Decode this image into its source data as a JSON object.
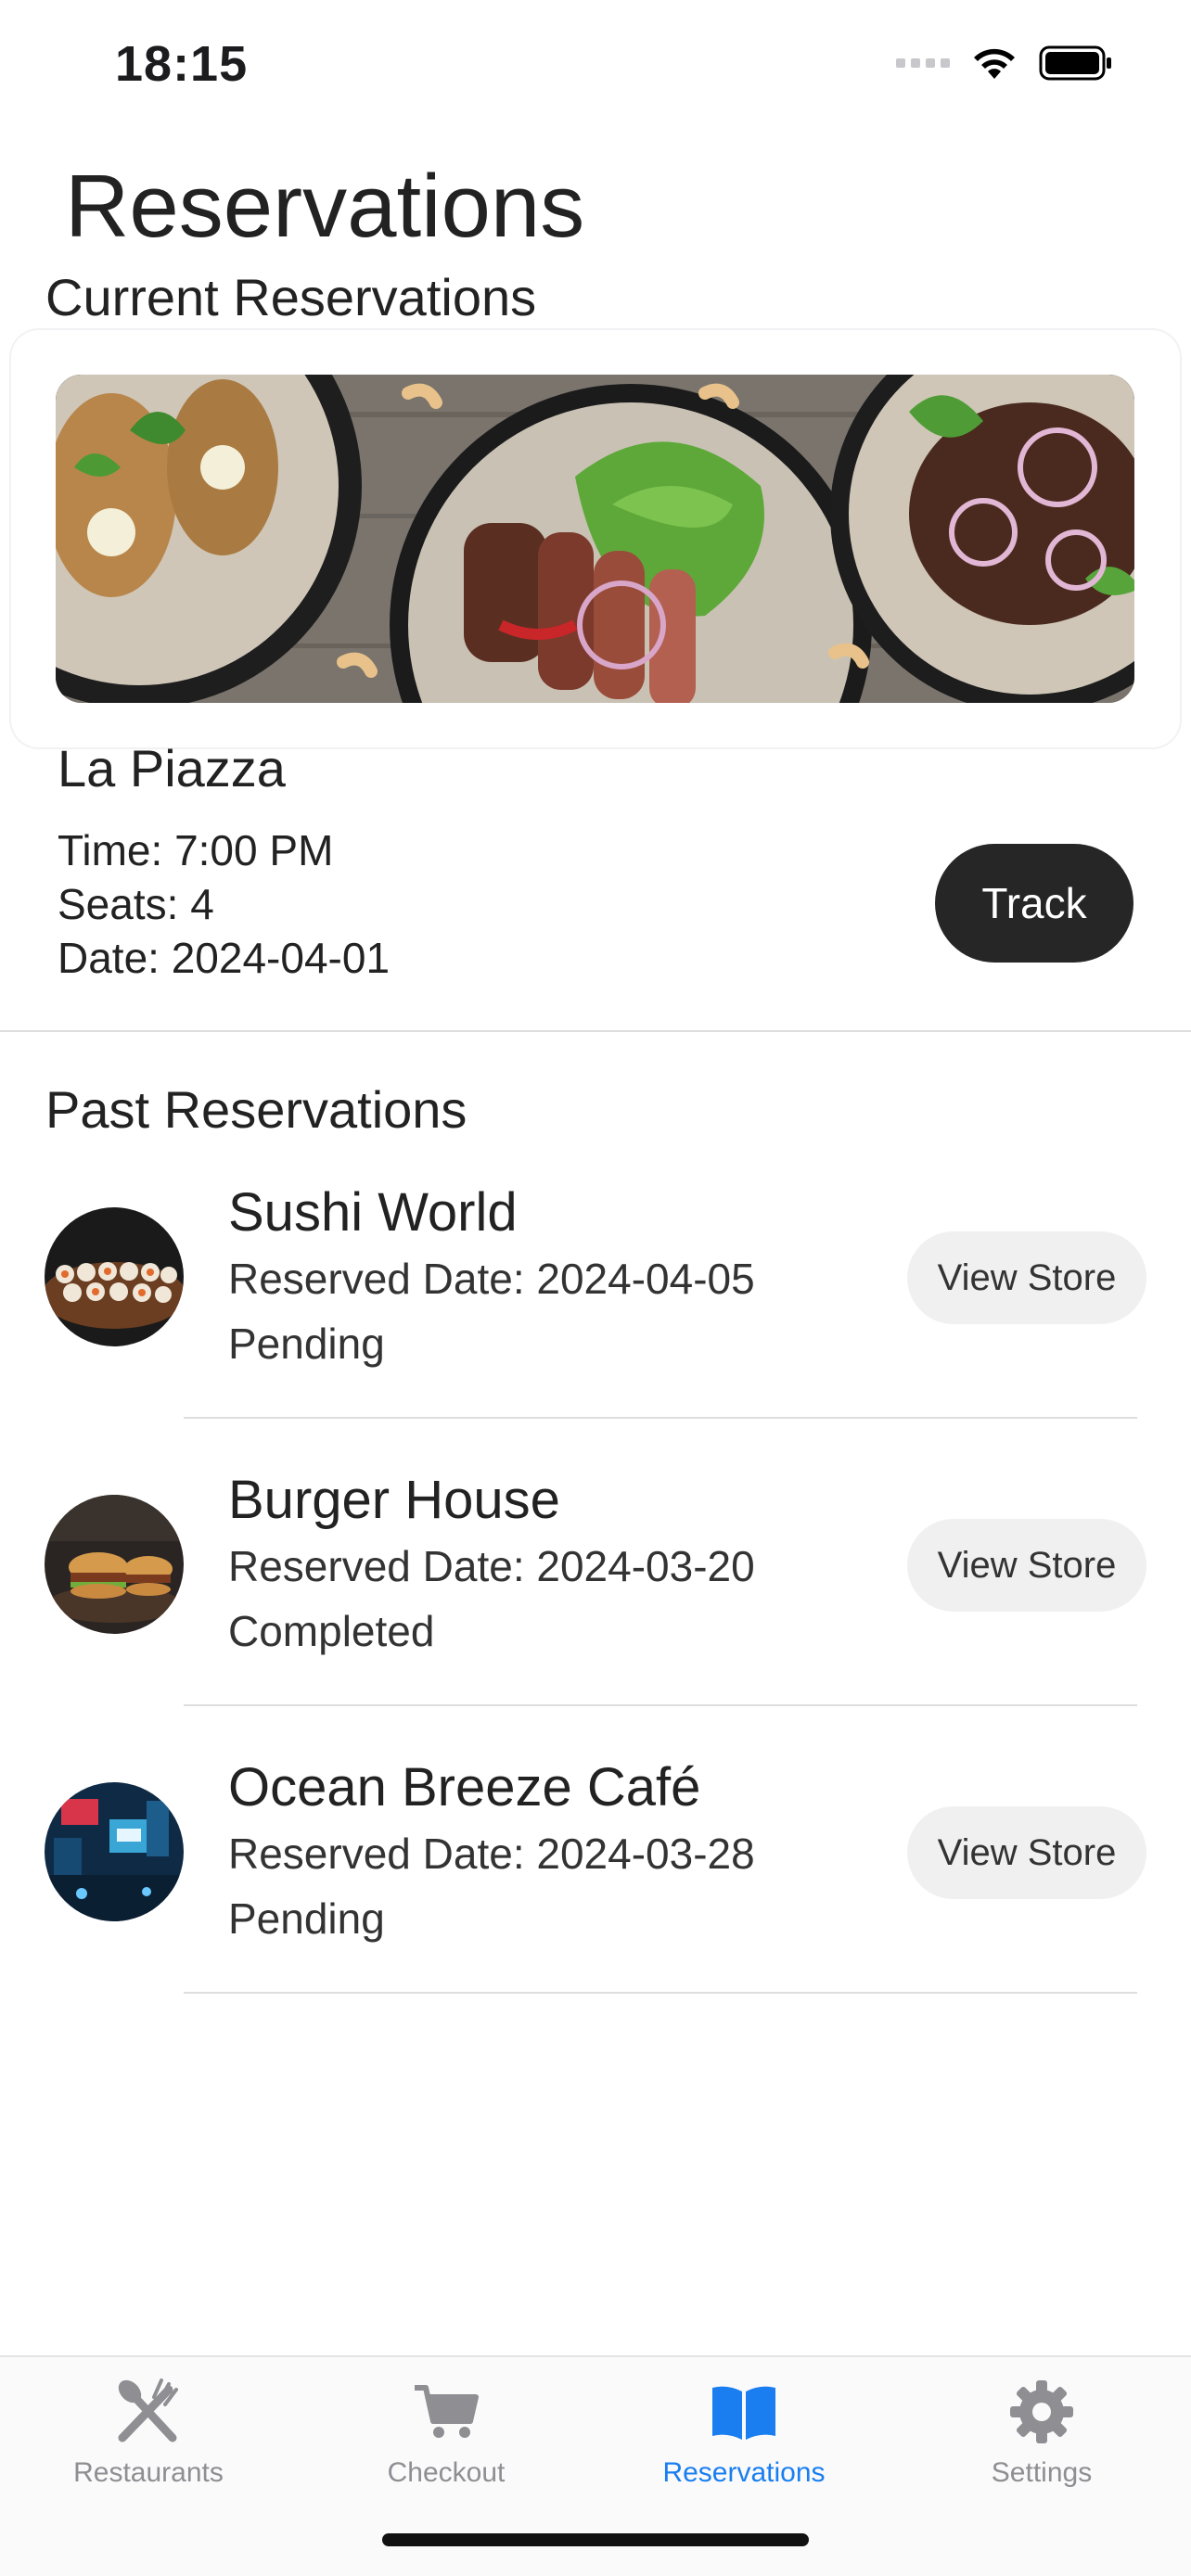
{
  "status_bar": {
    "time": "18:15"
  },
  "header": {
    "title": "Reservations"
  },
  "current": {
    "section_title": "Current Reservations",
    "restaurant_name": "La Piazza",
    "time": "Time: 7:00 PM",
    "seats": "Seats: 4",
    "date": "Date: 2024-04-01",
    "track_label": "Track"
  },
  "past": {
    "section_title": "Past Reservations",
    "items": [
      {
        "name": "Sushi World",
        "reserved_date": "Reserved Date: 2024-04-05",
        "status": "Pending",
        "button_label": "View Store"
      },
      {
        "name": "Burger House",
        "reserved_date": "Reserved Date: 2024-03-20",
        "status": "Completed",
        "button_label": "View Store"
      },
      {
        "name": "Ocean Breeze Café",
        "reserved_date": "Reserved Date: 2024-03-28",
        "status": "Pending",
        "button_label": "View Store"
      }
    ]
  },
  "tab_bar": {
    "tabs": [
      {
        "label": "Restaurants",
        "icon": "fork-knife-icon",
        "active": false
      },
      {
        "label": "Checkout",
        "icon": "cart-icon",
        "active": false
      },
      {
        "label": "Reservations",
        "icon": "book-icon",
        "active": true
      },
      {
        "label": "Settings",
        "icon": "gear-icon",
        "active": false
      }
    ],
    "active_color": "#1a7ef0",
    "inactive_color": "#8e8e93"
  }
}
